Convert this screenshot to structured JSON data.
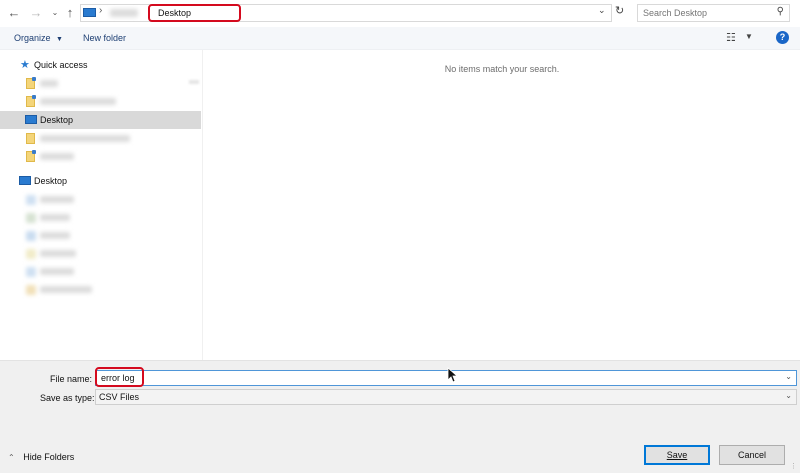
{
  "address_bar": {
    "path_active": "Desktop",
    "search_placeholder": "Search Desktop"
  },
  "toolbar": {
    "organize_label": "Organize",
    "new_folder_label": "New folder"
  },
  "nav": {
    "quick_access_label": "Quick access",
    "quick_desktop_label": "Desktop",
    "desktop_label": "Desktop"
  },
  "content": {
    "empty_message": "No items match your search."
  },
  "bottom": {
    "file_name_label": "File name:",
    "file_name_value": "error log",
    "save_type_label": "Save as type:",
    "save_type_value": "CSV Files",
    "hide_folders_label": "Hide Folders",
    "save_button": "Save",
    "cancel_button": "Cancel"
  },
  "colors": {
    "highlight": "#d40a1e",
    "accent": "#0078d7",
    "link": "#1e3f73"
  }
}
